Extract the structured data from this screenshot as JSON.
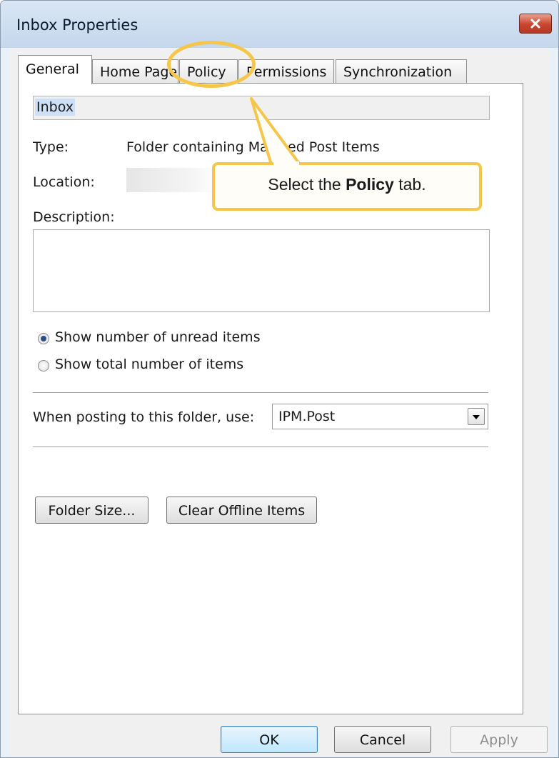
{
  "window": {
    "title": "Inbox Properties"
  },
  "tabs": [
    {
      "label": "General",
      "active": true
    },
    {
      "label": "Home Page"
    },
    {
      "label": "Policy"
    },
    {
      "label": "Permissions"
    },
    {
      "label": "Synchronization"
    }
  ],
  "general": {
    "folder_name": "Inbox",
    "type_label": "Type:",
    "type_value": "Folder containing Mail and Post Items",
    "type_value_visible_left": "Folder containing Ma",
    "type_value_visible_right": "ed Post Items",
    "location_label": "Location:",
    "description_label": "Description:",
    "description_value": "",
    "radio_unread_label": "Show number of unread items",
    "radio_total_label": "Show total number of items",
    "radio_selected": "unread",
    "posting_label": "When posting to this folder, use:",
    "posting_value": "IPM.Post",
    "folder_size_button": "Folder Size...",
    "clear_offline_button": "Clear Offline Items"
  },
  "footer": {
    "ok": "OK",
    "cancel": "Cancel",
    "apply": "Apply"
  },
  "callout": {
    "prefix": "Select the ",
    "emphasis": "Policy",
    "suffix": " tab."
  },
  "colors": {
    "highlight": "#f5c64a",
    "close_button": "#c9452e",
    "selection": "#cde0f7"
  }
}
